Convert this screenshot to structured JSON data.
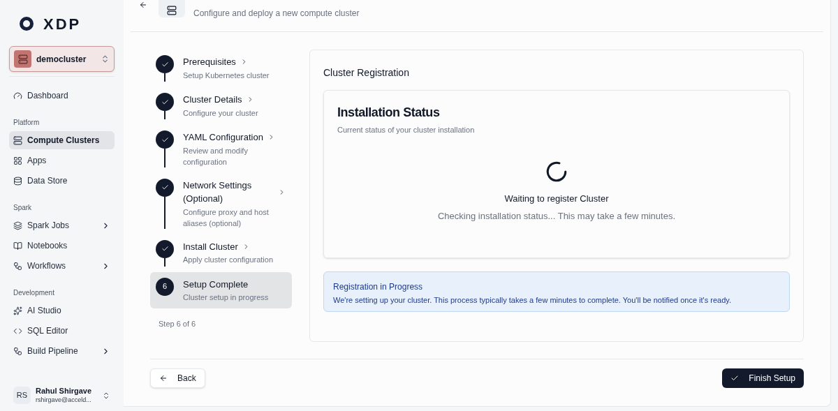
{
  "logo": {
    "text": "XDP"
  },
  "cluster_selector": {
    "name": "democluster"
  },
  "sidebar": {
    "top_items": [
      {
        "label": "Dashboard",
        "selected": false,
        "has_submenu": false
      }
    ],
    "groups": [
      {
        "title": "Platform",
        "items": [
          {
            "label": "Compute Clusters",
            "selected": true,
            "has_submenu": false
          },
          {
            "label": "Apps",
            "selected": false,
            "has_submenu": false
          },
          {
            "label": "Data Store",
            "selected": false,
            "has_submenu": false
          }
        ]
      },
      {
        "title": "Spark",
        "items": [
          {
            "label": "Spark Jobs",
            "selected": false,
            "has_submenu": true
          },
          {
            "label": "Notebooks",
            "selected": false,
            "has_submenu": false
          },
          {
            "label": "Workflows",
            "selected": false,
            "has_submenu": true
          }
        ]
      },
      {
        "title": "Development",
        "items": [
          {
            "label": "AI Studio",
            "selected": false,
            "has_submenu": false
          },
          {
            "label": "SQL Editor",
            "selected": false,
            "has_submenu": false
          },
          {
            "label": "Build Pipeline",
            "selected": false,
            "has_submenu": true
          }
        ]
      }
    ]
  },
  "user": {
    "initials": "RS",
    "name": "Rahul Shirgave",
    "email": "rshirgave@acceld..."
  },
  "header": {
    "subtitle": "Configure and deploy a new compute cluster"
  },
  "steps": [
    {
      "kind": "done",
      "title": "Prerequisites",
      "subtitle": "Setup Kubernetes cluster",
      "selected": false
    },
    {
      "kind": "done",
      "title": "Cluster Details",
      "subtitle": "Configure your cluster",
      "selected": false
    },
    {
      "kind": "done",
      "title": "YAML Configuration",
      "subtitle": "Review and modify configuration",
      "selected": false
    },
    {
      "kind": "done",
      "title": "Network Settings (Optional)",
      "subtitle": "Configure proxy and host aliases (optional)",
      "selected": false
    },
    {
      "kind": "done",
      "title": "Install Cluster",
      "subtitle": "Apply cluster configuration",
      "selected": false
    },
    {
      "kind": "current",
      "number": "6",
      "title": "Setup Complete",
      "subtitle": "Cluster setup in progress",
      "selected": true
    }
  ],
  "step_counter": "Step 6 of 6",
  "panel": {
    "title": "Cluster Registration",
    "status_card": {
      "title": "Installation Status",
      "subtitle": "Current status of your cluster installation",
      "message": "Waiting to register Cluster",
      "detail": "Checking installation status... This may take a few minutes."
    },
    "notice": {
      "title": "Registration in Progress",
      "text": "We're setting up your cluster. This process typically takes a few minutes to complete. You'll be notified once it's ready."
    }
  },
  "buttons": {
    "back": "Back",
    "finish": "Finish Setup"
  }
}
